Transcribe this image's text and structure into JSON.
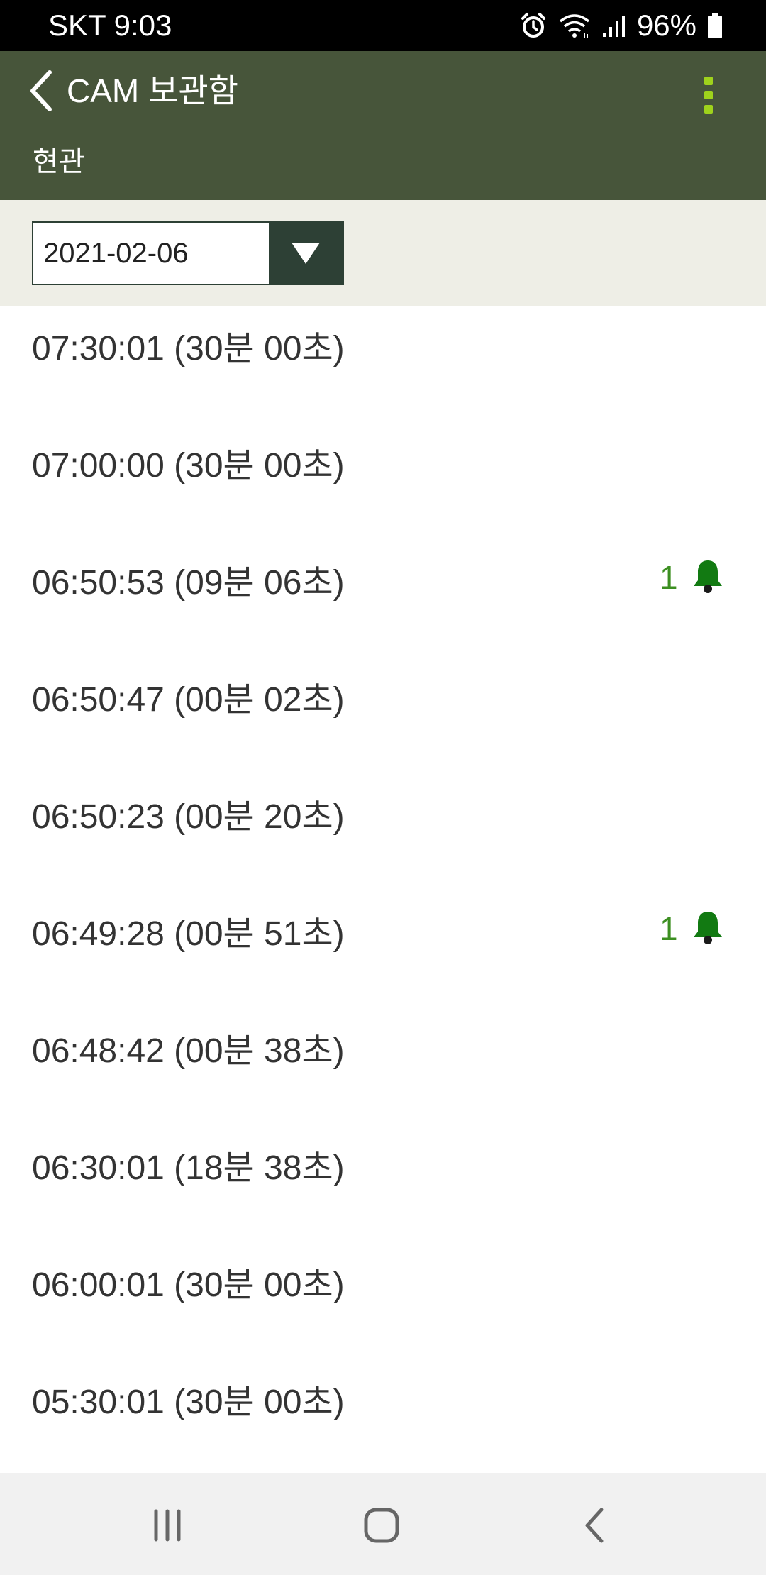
{
  "status_bar": {
    "carrier_time": "SKT 9:03",
    "battery": "96%",
    "icons": [
      "alarm-icon",
      "wifi-icon",
      "signal-icon",
      "battery-icon"
    ]
  },
  "app_bar": {
    "title": "CAM 보관함",
    "subtitle": "현관",
    "colors": {
      "background": "#47553a",
      "menu_dots": "#9fd21c"
    }
  },
  "filter": {
    "selected_date": "2021-02-06",
    "arrow_color": "#2d4035"
  },
  "recordings": [
    {
      "time": "07:30:01 (30분 00초)",
      "events": null
    },
    {
      "time": "07:00:00 (30분 00초)",
      "events": null
    },
    {
      "time": "06:50:53 (09분 06초)",
      "events": "1"
    },
    {
      "time": "06:50:47 (00분 02초)",
      "events": null
    },
    {
      "time": "06:50:23 (00분 20초)",
      "events": null
    },
    {
      "time": "06:49:28 (00분 51초)",
      "events": "1"
    },
    {
      "time": "06:48:42 (00분 38초)",
      "events": null
    },
    {
      "time": "06:30:01 (18분 38초)",
      "events": null
    },
    {
      "time": "06:00:01 (30분 00초)",
      "events": null
    },
    {
      "time": "05:30:01 (30분 00초)",
      "events": null
    }
  ],
  "event_color": "#127a12",
  "nav_bar": {
    "icons": [
      "recent-apps-icon",
      "home-icon",
      "back-icon"
    ]
  }
}
